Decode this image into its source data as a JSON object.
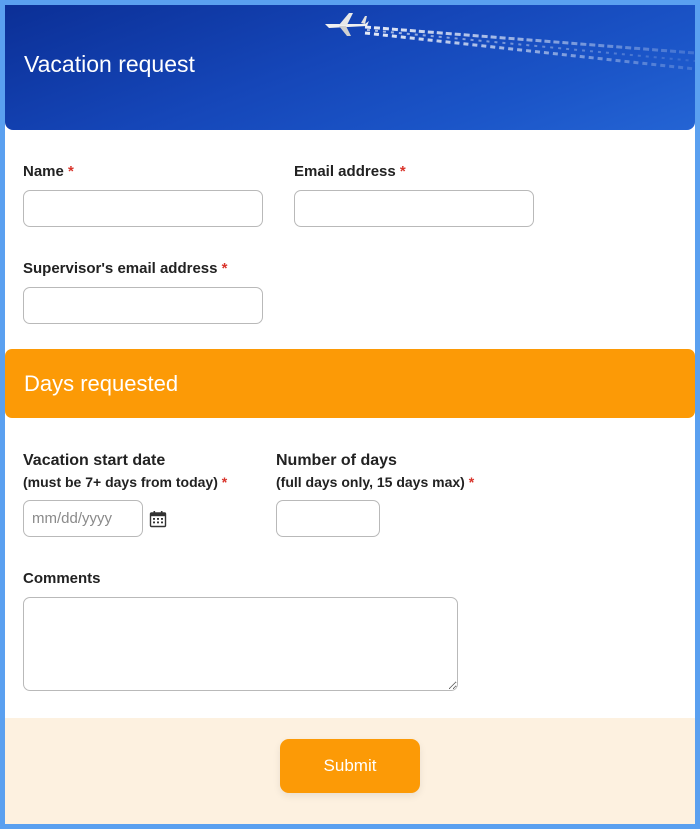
{
  "header": {
    "title": "Vacation request"
  },
  "fields": {
    "name": {
      "label": "Name",
      "required": "*"
    },
    "email": {
      "label": "Email address",
      "required": "*"
    },
    "supervisor_email": {
      "label": "Supervisor's email address",
      "required": "*"
    }
  },
  "section": {
    "title": "Days requested"
  },
  "vacation": {
    "start_label": "Vacation start date",
    "start_sublabel": "(must be 7+ days from today)",
    "start_required": "*",
    "start_placeholder": "mm/dd/yyyy",
    "days_label": "Number of days",
    "days_sublabel": "(full days only, 15 days max)",
    "days_required": "*"
  },
  "comments": {
    "label": "Comments"
  },
  "footer": {
    "submit_label": "Submit"
  },
  "colors": {
    "banner": "#1546b8",
    "section": "#fc9a06",
    "required": "#d9342b",
    "footer": "#fdf1e0",
    "frame": "#5aa0f0"
  },
  "icons": {
    "date_picker": "calendar-icon",
    "banner_art": "airplane-icon"
  }
}
